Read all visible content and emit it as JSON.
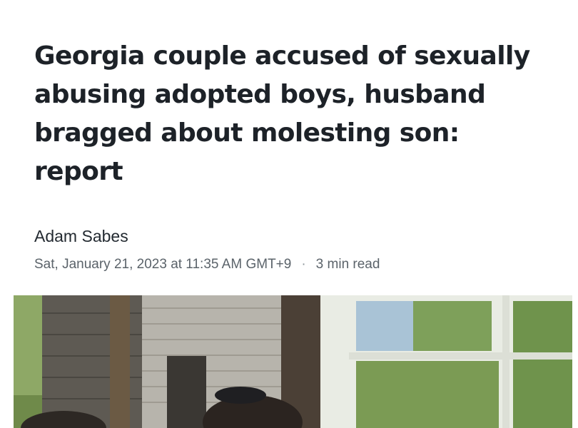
{
  "article": {
    "headline": "Georgia couple accused of sexually abusing adopted boys, husband bragged about molesting son: report",
    "author": "Adam Sabes",
    "date": "Sat, January 21, 2023 at 11:35 AM GMT+9",
    "separator": "·",
    "read_time": "3 min read"
  },
  "hero_image": {
    "icon": "photo"
  }
}
